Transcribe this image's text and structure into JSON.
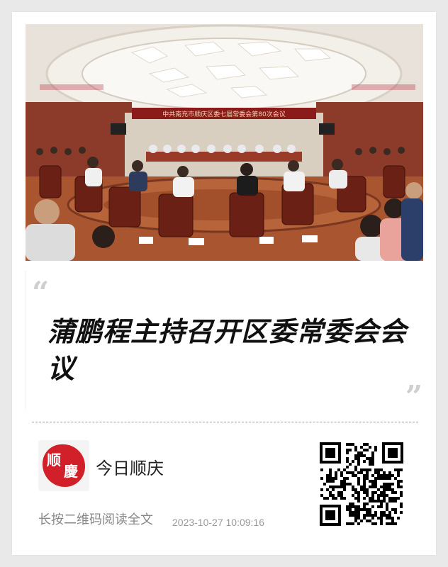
{
  "article": {
    "banner_text": "中共南充市顺庆区委七届常委会第80次会议",
    "title": "蒲鹏程主持召开区委常委会会议",
    "quote_open": "“",
    "quote_close": "”"
  },
  "footer": {
    "account_name": "今日顺庆",
    "logo_text": "顺慶",
    "hint": "长按二维码阅读全文",
    "timestamp": "2023-10-27 10:09:16"
  },
  "colors": {
    "background": "#e9e9e9",
    "card": "#ffffff",
    "logo_red": "#d1202a",
    "banner_red": "#8b1a1a"
  },
  "icons": {
    "qr": "qr-code-icon",
    "logo": "account-logo-icon"
  }
}
